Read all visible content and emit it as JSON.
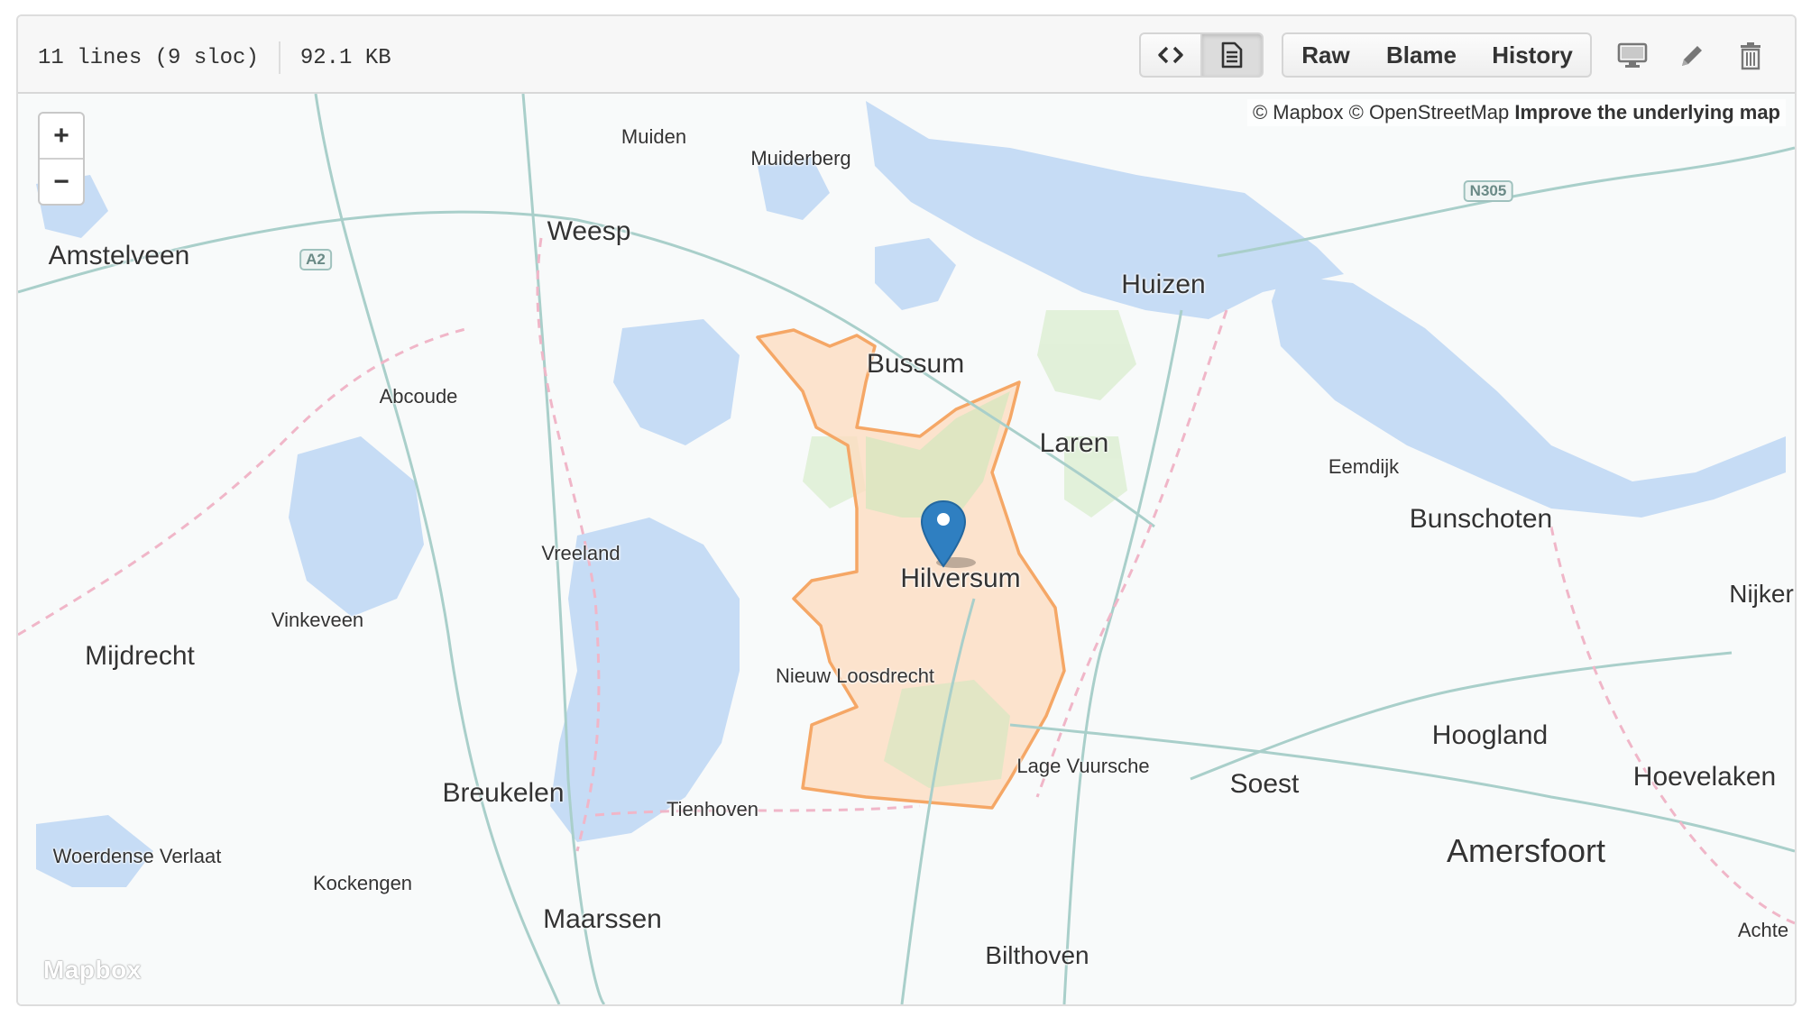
{
  "file_info": {
    "lines": "11 lines (9 sloc)",
    "size": "92.1 KB"
  },
  "toolbar": {
    "code_view_icon": "code-icon",
    "rendered_view_icon": "file-text-icon",
    "raw_label": "Raw",
    "blame_label": "Blame",
    "history_label": "History",
    "desktop_icon": "device-desktop-icon",
    "edit_icon": "pencil-icon",
    "delete_icon": "trashcan-icon"
  },
  "map": {
    "zoom_in": "+",
    "zoom_out": "−",
    "attribution_prefix": "© Mapbox © OpenStreetMap ",
    "attribution_link": "Improve the underlying map",
    "logo": "Mapbox",
    "marker_icon": "map-pin-icon",
    "region_fill": "#fcdcc0",
    "region_stroke": "#f5a766",
    "marker_color": "#2f7fc1",
    "water_color": "#c6dcf5",
    "places": [
      {
        "id": "amstelveen",
        "name": "Amstelveen"
      },
      {
        "id": "weesp",
        "name": "Weesp"
      },
      {
        "id": "muiden",
        "name": "Muiden"
      },
      {
        "id": "muiderberg",
        "name": "Muiderberg"
      },
      {
        "id": "huizen",
        "name": "Huizen"
      },
      {
        "id": "bussum",
        "name": "Bussum"
      },
      {
        "id": "abcoude",
        "name": "Abcoude"
      },
      {
        "id": "laren",
        "name": "Laren"
      },
      {
        "id": "eemdijk",
        "name": "Eemdijk"
      },
      {
        "id": "bunschoten",
        "name": "Bunschoten"
      },
      {
        "id": "vreeland",
        "name": "Vreeland"
      },
      {
        "id": "hilversum",
        "name": "Hilversum"
      },
      {
        "id": "nijkerk",
        "name": "Nijkerk"
      },
      {
        "id": "vinkeveen",
        "name": "Vinkeveen"
      },
      {
        "id": "mijdrecht",
        "name": "Mijdrecht"
      },
      {
        "id": "nieuw-loosdrecht",
        "name": "Nieuw Loosdrecht"
      },
      {
        "id": "hoogland",
        "name": "Hoogland"
      },
      {
        "id": "lage-vuursche",
        "name": "Lage Vuursche"
      },
      {
        "id": "soest",
        "name": "Soest"
      },
      {
        "id": "hoevelaken",
        "name": "Hoevelaken"
      },
      {
        "id": "breukelen",
        "name": "Breukelen"
      },
      {
        "id": "tienhoven",
        "name": "Tienhoven"
      },
      {
        "id": "amersfoort",
        "name": "Amersfoort"
      },
      {
        "id": "woerdense-verlaat",
        "name": "Woerdense Verlaat"
      },
      {
        "id": "kockengen",
        "name": "Kockengen"
      },
      {
        "id": "maarssen",
        "name": "Maarssen"
      },
      {
        "id": "bilthoven",
        "name": "Bilthoven"
      },
      {
        "id": "achte",
        "name": "Achte"
      }
    ],
    "road_shields": [
      {
        "id": "a2",
        "label": "A2"
      },
      {
        "id": "n305",
        "label": "N305"
      }
    ]
  }
}
